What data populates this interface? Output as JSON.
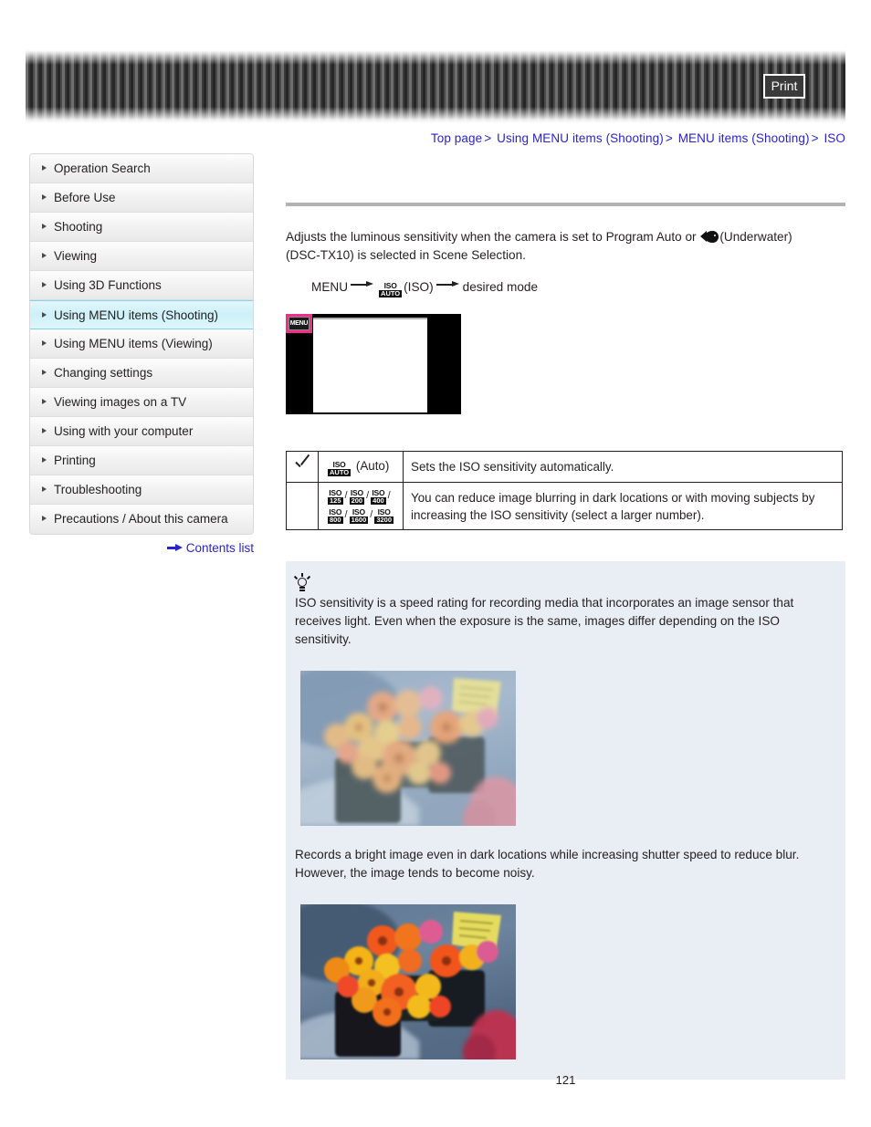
{
  "header": {
    "print_label": "Print"
  },
  "breadcrumb": {
    "items": [
      "Top page",
      "Using MENU items (Shooting)",
      "MENU items (Shooting)",
      "ISO"
    ],
    "separator": ">"
  },
  "sidebar": {
    "items": [
      {
        "label": "Operation Search",
        "active": false
      },
      {
        "label": "Before Use",
        "active": false
      },
      {
        "label": "Shooting",
        "active": false
      },
      {
        "label": "Viewing",
        "active": false
      },
      {
        "label": "Using 3D Functions",
        "active": false
      },
      {
        "label": "Using MENU items (Shooting)",
        "active": true
      },
      {
        "label": "Using MENU items (Viewing)",
        "active": false
      },
      {
        "label": "Changing settings",
        "active": false
      },
      {
        "label": "Viewing images on a TV",
        "active": false
      },
      {
        "label": "Using with your computer",
        "active": false
      },
      {
        "label": "Printing",
        "active": false
      },
      {
        "label": "Troubleshooting",
        "active": false
      },
      {
        "label": "Precautions / About this camera",
        "active": false
      }
    ],
    "contents_link": "Contents list"
  },
  "main": {
    "intro_part1": "Adjusts the luminous sensitivity when the camera is set to Program Auto or",
    "intro_icon_label": "(Underwater)",
    "intro_part2": "(DSC-TX10) is selected in Scene Selection.",
    "menu_path": {
      "start": "MENU",
      "iso_top": "ISO",
      "iso_bottom": "AUTO",
      "iso_label": "(ISO)",
      "end": "desired mode"
    },
    "camera_illustration": {
      "menu_chip_label": "MENU"
    }
  },
  "table": {
    "rows": [
      {
        "checked": true,
        "icon_top": "ISO",
        "icon_bottom": "AUTO",
        "icon_label": "(Auto)",
        "description": "Sets the ISO sensitivity automatically."
      },
      {
        "checked": false,
        "iso_values_line1": [
          "125",
          "200",
          "400"
        ],
        "iso_values_line2": [
          "800",
          "1600",
          "3200"
        ],
        "icon_top": "ISO",
        "description": "You can reduce image blurring in dark locations or with moving subjects by increasing the ISO sensitivity (select a larger number)."
      }
    ]
  },
  "tip": {
    "icon": "lightbulb-icon",
    "text": "ISO sensitivity is a speed rating for recording media that incorporates an image sensor that receives light. Even when the exposure is the same, images differ depending on the ISO sensitivity.",
    "photo1_alt": "Blurred washed-out photo of orange and yellow gerbera flowers in dark pots",
    "caption": "Records a bright image even in dark locations while increasing shutter speed to reduce blur. However, the image tends to become noisy.",
    "photo2_alt": "Sharper saturated photo of orange and yellow gerbera flowers in dark pots"
  },
  "footer": {
    "page_number": "121"
  },
  "colors": {
    "link": "#2a23c8",
    "accent_highlight": "#cdf0f8",
    "accent_border": "#7fd4e8",
    "tip_bg": "#e9eef4",
    "pink_marker": "#ef2d8b",
    "rule": "#b2b2b2"
  }
}
